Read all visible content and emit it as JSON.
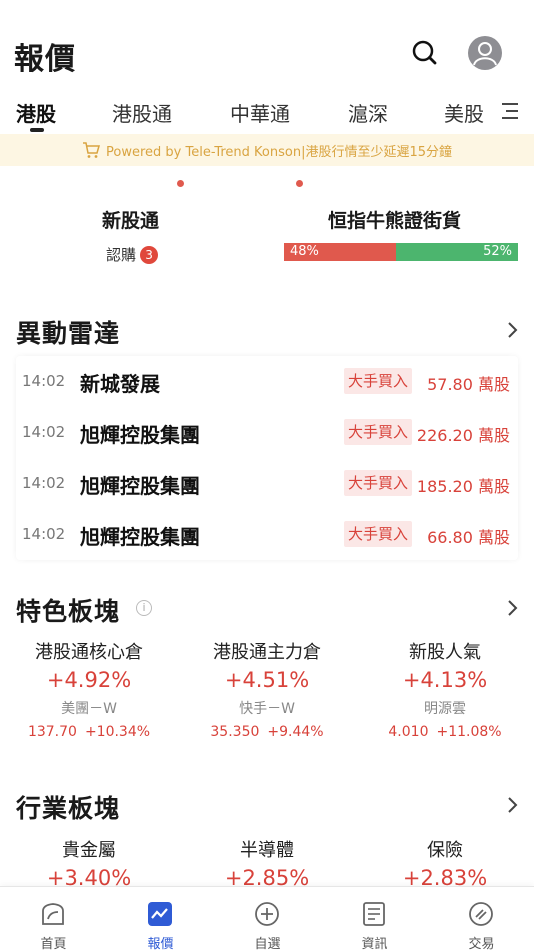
{
  "header": {
    "title": "報價",
    "search_icon": "search-icon",
    "avatar_icon": "user-icon"
  },
  "tabs": [
    {
      "label": "港股",
      "active": true,
      "dot": false
    },
    {
      "label": "港股通",
      "active": false,
      "dot": true
    },
    {
      "label": "中華通",
      "active": false,
      "dot": true
    },
    {
      "label": "滬深",
      "active": false,
      "dot": false
    },
    {
      "label": "美股",
      "active": false,
      "dot": false
    }
  ],
  "notice": {
    "text": "Powered by Tele-Trend Konson|港股行情至少延遲15分鐘",
    "icon": "cart-icon"
  },
  "quick": {
    "ipo_title": "新股通",
    "ipo_sub": "認購",
    "ipo_badge": "3",
    "cbbc_title": "恒指牛熊證街貨",
    "bull_pct": "48%",
    "bear_pct": "52%",
    "bull_fraction": 0.48
  },
  "radar": {
    "title": "異動雷達",
    "rows": [
      {
        "time": "14:02",
        "name": "新城發展",
        "tag": "大手買入",
        "value": "57.80 萬股"
      },
      {
        "time": "14:02",
        "name": "旭輝控股集團",
        "tag": "大手買入",
        "value": "226.20 萬股"
      },
      {
        "time": "14:02",
        "name": "旭輝控股集團",
        "tag": "大手買入",
        "value": "185.20 萬股"
      },
      {
        "time": "14:02",
        "name": "旭輝控股集團",
        "tag": "大手買入",
        "value": "66.80 萬股"
      }
    ]
  },
  "featured": {
    "title": "特色板塊",
    "info_icon": "i",
    "items": [
      {
        "name": "港股通核心倉",
        "pct": "+4.92%",
        "stock": "美團－W",
        "price": "137.70",
        "change": "+10.34%"
      },
      {
        "name": "港股通主力倉",
        "pct": "+4.51%",
        "stock": "快手－W",
        "price": "35.350",
        "change": "+9.44%"
      },
      {
        "name": "新股人氣",
        "pct": "+4.13%",
        "stock": "明源雲",
        "price": "4.010",
        "change": "+11.08%"
      }
    ]
  },
  "industry": {
    "title": "行業板塊",
    "items": [
      {
        "name": "貴金屬",
        "pct": "+3.40%"
      },
      {
        "name": "半導體",
        "pct": "+2.85%"
      },
      {
        "name": "保險",
        "pct": "+2.83%"
      }
    ]
  },
  "nav": [
    {
      "label": "首頁",
      "icon": "home-icon",
      "active": false
    },
    {
      "label": "報價",
      "icon": "chart-icon",
      "active": true
    },
    {
      "label": "自選",
      "icon": "add-circle-icon",
      "active": false
    },
    {
      "label": "資訊",
      "icon": "document-icon",
      "active": false
    },
    {
      "label": "交易",
      "icon": "trade-icon",
      "active": false
    }
  ],
  "colors": {
    "up": "#d8423a",
    "down": "#4cb56e",
    "accent": "#2f5bd5",
    "notice_bg": "#fdf6e3"
  }
}
